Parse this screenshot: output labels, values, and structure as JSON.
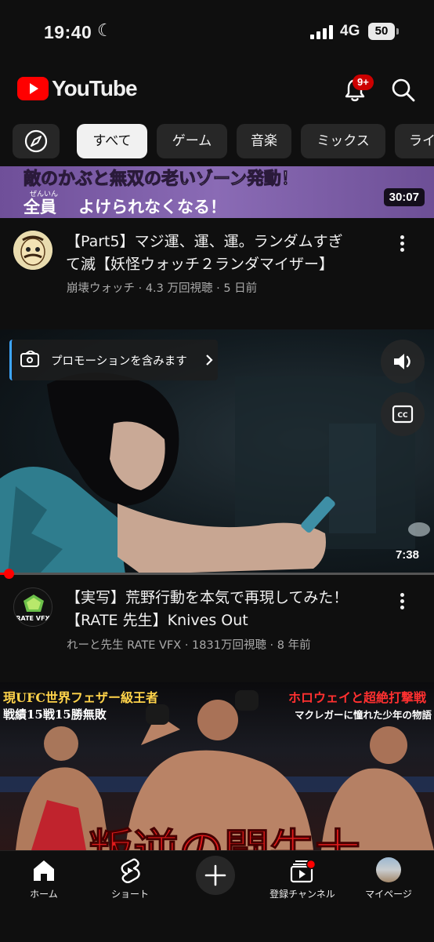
{
  "status_bar": {
    "time": "19:40",
    "network": "4G",
    "battery": "50"
  },
  "app_bar": {
    "logo_text": "YouTube",
    "notification_badge": "9+"
  },
  "chips": [
    {
      "label": "すべて",
      "active": true
    },
    {
      "label": "ゲーム"
    },
    {
      "label": "音楽"
    },
    {
      "label": "ミックス"
    },
    {
      "label": "ライ"
    }
  ],
  "videos": [
    {
      "thumb_caption_line1": "敵のかぶと無双の老いゾーン発動！",
      "thumb_caption_line2": "全員",
      "thumb_caption_ruby": "ぜんいん",
      "thumb_caption_line2b": "よけられなくなる！",
      "duration": "30:07",
      "title_line1": "【Part5】マジ運、運、運。ランダムすぎ",
      "title_line2": "て滅【妖怪ウォッチ２ランダマイザー】",
      "meta": "崩壊ウォッチ · 4.3 万回視聴 · 5 日前"
    },
    {
      "promo_label": "プロモーションを含みます",
      "duration": "7:38",
      "progress": 0.02,
      "channel_avatar_text": "RATE VFX",
      "title_line1": "【実写】荒野行動を本気で再現してみた！",
      "title_line2": "【RATE 先生】Knives Out",
      "meta": "れーと先生 RATE VFX · 1831万回視聴 · 8 年前"
    },
    {
      "thumb_text_left1": "現UFC世界フェザー級王者",
      "thumb_text_left2": "戦績15戦15勝無敗",
      "thumb_text_right1": "ホロウェイと超絶打撃戦",
      "thumb_text_right2": "マクレガーに憧れた少年の物語",
      "thumb_text_big": "叛逆の闘牛士"
    }
  ],
  "bottom_nav": [
    {
      "label": "ホーム"
    },
    {
      "label": "ショート"
    },
    {
      "label": ""
    },
    {
      "label": "登録チャンネル"
    },
    {
      "label": "マイページ"
    }
  ],
  "colors": {
    "brand_red": "#ff0000",
    "background": "#0f0f0f",
    "chip": "#272727",
    "promo_accent": "#3ea6ff",
    "progress": "#ff0000"
  }
}
